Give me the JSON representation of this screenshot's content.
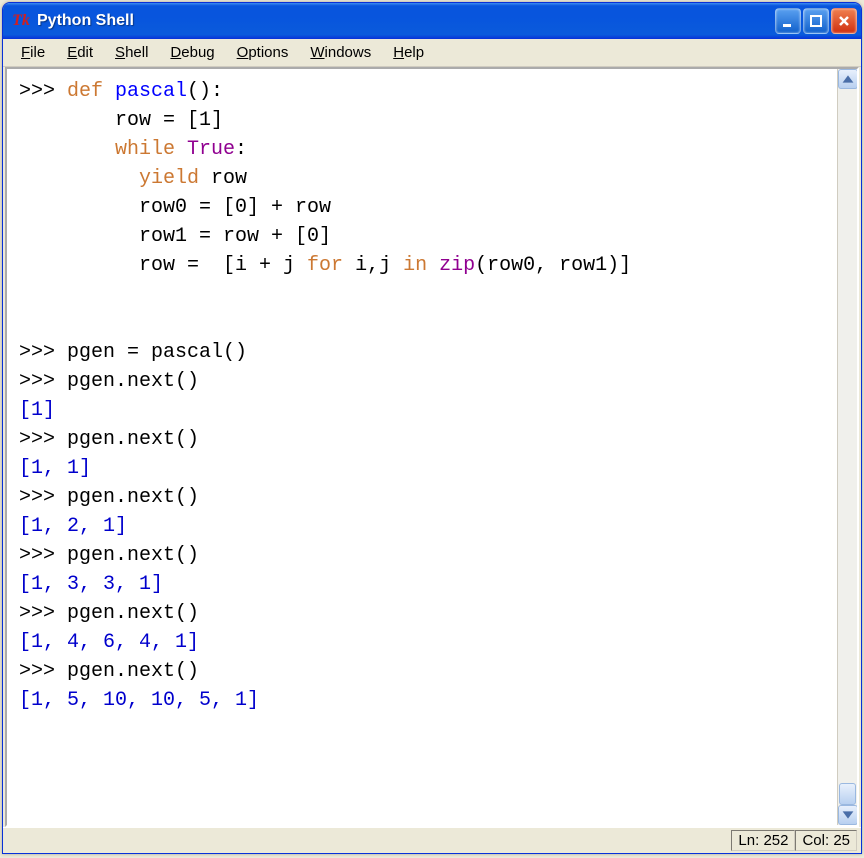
{
  "window": {
    "title": "Python Shell"
  },
  "menubar": {
    "items": [
      {
        "hotkey": "F",
        "rest": "ile"
      },
      {
        "hotkey": "E",
        "rest": "dit"
      },
      {
        "hotkey": "S",
        "rest": "hell"
      },
      {
        "hotkey": "D",
        "rest": "ebug"
      },
      {
        "hotkey": "O",
        "rest": "ptions"
      },
      {
        "hotkey": "W",
        "rest": "indows"
      },
      {
        "hotkey": "H",
        "rest": "elp"
      }
    ]
  },
  "code": {
    "prompt": ">>> ",
    "blank_prompt": "    ",
    "lines": [
      {
        "type": "code",
        "prompt": true,
        "tokens": [
          {
            "t": "def ",
            "c": "kw-orange"
          },
          {
            "t": "pascal",
            "c": "kw-blue"
          },
          {
            "t": "():",
            "c": ""
          }
        ]
      },
      {
        "type": "code",
        "prompt": false,
        "indent": "    ",
        "tokens": [
          {
            "t": "row = [1]",
            "c": ""
          }
        ]
      },
      {
        "type": "code",
        "prompt": false,
        "indent": "    ",
        "tokens": [
          {
            "t": "while ",
            "c": "kw-orange"
          },
          {
            "t": "True",
            "c": "kw-purple"
          },
          {
            "t": ":",
            "c": ""
          }
        ]
      },
      {
        "type": "code",
        "prompt": false,
        "indent": "      ",
        "tokens": [
          {
            "t": "yield ",
            "c": "kw-orange"
          },
          {
            "t": "row",
            "c": ""
          }
        ]
      },
      {
        "type": "code",
        "prompt": false,
        "indent": "      ",
        "tokens": [
          {
            "t": "row0 = [0] + row",
            "c": ""
          }
        ]
      },
      {
        "type": "code",
        "prompt": false,
        "indent": "      ",
        "tokens": [
          {
            "t": "row1 = row + [0]",
            "c": ""
          }
        ]
      },
      {
        "type": "code",
        "prompt": false,
        "indent": "      ",
        "tokens": [
          {
            "t": "row =  [i + j ",
            "c": ""
          },
          {
            "t": "for ",
            "c": "kw-orange"
          },
          {
            "t": "i,j ",
            "c": ""
          },
          {
            "t": "in ",
            "c": "kw-orange"
          },
          {
            "t": "zip",
            "c": "kw-purple"
          },
          {
            "t": "(row0, row1)]",
            "c": ""
          }
        ]
      },
      {
        "type": "blank"
      },
      {
        "type": "blank"
      },
      {
        "type": "code",
        "prompt": true,
        "tokens": [
          {
            "t": "pgen = pascal()",
            "c": ""
          }
        ]
      },
      {
        "type": "code",
        "prompt": true,
        "tokens": [
          {
            "t": "pgen.next()",
            "c": ""
          }
        ]
      },
      {
        "type": "output",
        "text": "[1]"
      },
      {
        "type": "code",
        "prompt": true,
        "tokens": [
          {
            "t": "pgen.next()",
            "c": ""
          }
        ]
      },
      {
        "type": "output",
        "text": "[1, 1]"
      },
      {
        "type": "code",
        "prompt": true,
        "tokens": [
          {
            "t": "pgen.next()",
            "c": ""
          }
        ]
      },
      {
        "type": "output",
        "text": "[1, 2, 1]"
      },
      {
        "type": "code",
        "prompt": true,
        "tokens": [
          {
            "t": "pgen.next()",
            "c": ""
          }
        ]
      },
      {
        "type": "output",
        "text": "[1, 3, 3, 1]"
      },
      {
        "type": "code",
        "prompt": true,
        "tokens": [
          {
            "t": "pgen.next()",
            "c": ""
          }
        ]
      },
      {
        "type": "output",
        "text": "[1, 4, 6, 4, 1]"
      },
      {
        "type": "code",
        "prompt": true,
        "tokens": [
          {
            "t": "pgen.next()",
            "c": ""
          }
        ]
      },
      {
        "type": "output",
        "text": "[1, 5, 10, 10, 5, 1]"
      }
    ]
  },
  "status": {
    "line_label": "Ln: ",
    "line_value": "252",
    "col_label": "Col: ",
    "col_value": "25"
  }
}
